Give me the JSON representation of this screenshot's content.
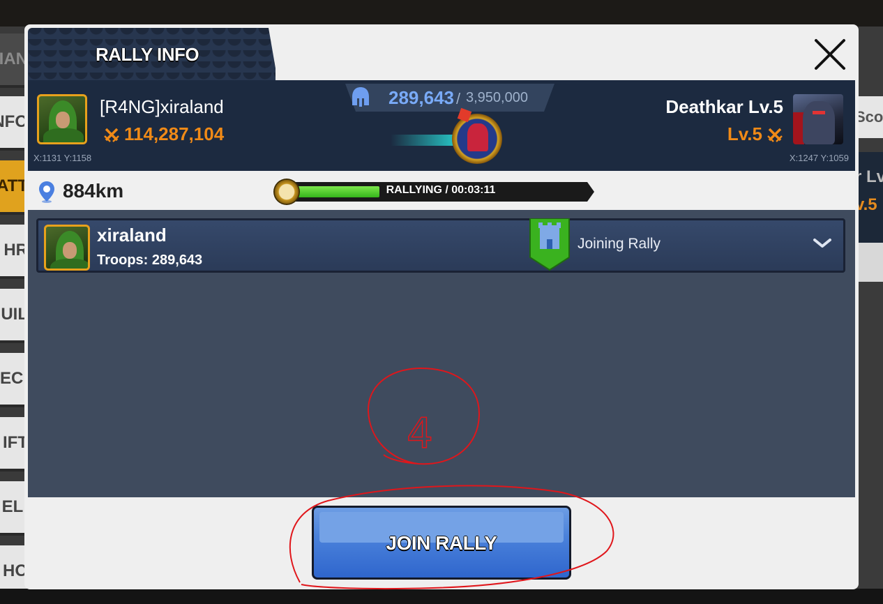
{
  "background": {
    "left_tabs": [
      "IAN",
      "NFO",
      "ATT",
      "HR",
      "UIL",
      "ECI",
      "IFT",
      "ELI",
      "HO"
    ],
    "right_tab_1": "Scor",
    "right_tab_2": "r Lv",
    "right_tab_2_level": "v.5"
  },
  "modal": {
    "title": "RALLY INFO",
    "close_icon": "close-icon"
  },
  "leader": {
    "name": "[R4NG]xiraland",
    "power": "114,287,104",
    "coords": "X:1131 Y:1158"
  },
  "troops": {
    "current": "289,643",
    "separator": "/",
    "max": "3,950,000"
  },
  "target": {
    "name": "Deathkar Lv.5",
    "level": "Lv.5",
    "coords": "X:1247 Y:1059"
  },
  "distance": "884km",
  "progress": {
    "label": "RALLYING / 00:03:11",
    "fraction": 0.3
  },
  "members": [
    {
      "name": "xiraland",
      "troops": "Troops: 289,643",
      "status": "Joining Rally"
    }
  ],
  "join_button": "JOIN RALLY",
  "annotation_label": "4",
  "colors": {
    "accent_orange": "#f08a17",
    "troop_blue": "#79aaf7",
    "annotation_red": "#e0161b",
    "button_blue": "#4b82db"
  }
}
